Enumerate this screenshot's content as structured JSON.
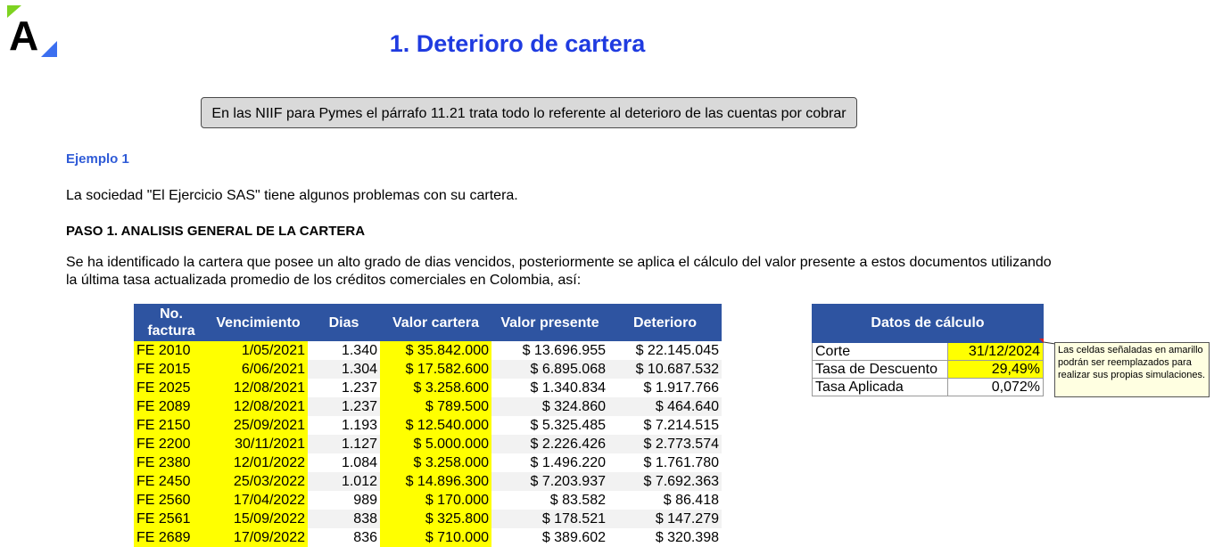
{
  "title": "1. Deterioro de cartera",
  "niif_note": "En las NIIF para Pymes el párrafo 11.21 trata todo lo referente al deterioro de las cuentas por cobrar",
  "ejemplo": "Ejemplo 1",
  "intro": "La sociedad \"El Ejercicio SAS\" tiene algunos problemas con su cartera.",
  "paso": "PASO 1. ANALISIS GENERAL DE LA CARTERA",
  "descripcion": "Se ha identificado la cartera que posee un alto grado de dias vencidos, posteriormente se aplica el cálculo del valor presente a estos documentos utilizando la última tasa actualizada promedio de los créditos comerciales en Colombia, así:",
  "colors": {
    "header_blue": "#2e54a1",
    "highlight_yellow": "#ffff00",
    "title_blue": "#1f3be0"
  },
  "cartera": {
    "headers": [
      "No. factura",
      "Vencimiento",
      "Dias",
      "Valor cartera",
      "Valor presente",
      "Deterioro"
    ],
    "rows": [
      [
        "FE 2010",
        "1/05/2021",
        "1.340",
        "$ 35.842.000",
        "$ 13.696.955",
        "$ 22.145.045"
      ],
      [
        "FE 2015",
        "6/06/2021",
        "1.304",
        "$ 17.582.600",
        "$ 6.895.068",
        "$ 10.687.532"
      ],
      [
        "FE 2025",
        "12/08/2021",
        "1.237",
        "$ 3.258.600",
        "$ 1.340.834",
        "$ 1.917.766"
      ],
      [
        "FE 2089",
        "12/08/2021",
        "1.237",
        "$ 789.500",
        "$ 324.860",
        "$ 464.640"
      ],
      [
        "FE 2150",
        "25/09/2021",
        "1.193",
        "$ 12.540.000",
        "$ 5.325.485",
        "$ 7.214.515"
      ],
      [
        "FE 2200",
        "30/11/2021",
        "1.127",
        "$ 5.000.000",
        "$ 2.226.426",
        "$ 2.773.574"
      ],
      [
        "FE 2380",
        "12/01/2022",
        "1.084",
        "$ 3.258.000",
        "$ 1.496.220",
        "$ 1.761.780"
      ],
      [
        "FE 2450",
        "25/03/2022",
        "1.012",
        "$ 14.896.300",
        "$ 7.203.937",
        "$ 7.692.363"
      ],
      [
        "FE 2560",
        "17/04/2022",
        "989",
        "$ 170.000",
        "$ 83.582",
        "$ 86.418"
      ],
      [
        "FE 2561",
        "15/09/2022",
        "838",
        "$ 325.800",
        "$ 178.521",
        "$ 147.279"
      ],
      [
        "FE 2689",
        "17/09/2022",
        "836",
        "$ 710.000",
        "$ 389.602",
        "$ 320.398"
      ]
    ]
  },
  "datos": {
    "header": "Datos de cálculo",
    "rows": [
      [
        "Corte",
        "31/12/2024"
      ],
      [
        "Tasa de Descuento",
        "29,49%"
      ],
      [
        "Tasa Aplicada",
        "0,072%"
      ]
    ]
  },
  "comment": "Las celdas señaladas en amarillo podrán ser reemplazados para realizar sus propias simulaciones."
}
